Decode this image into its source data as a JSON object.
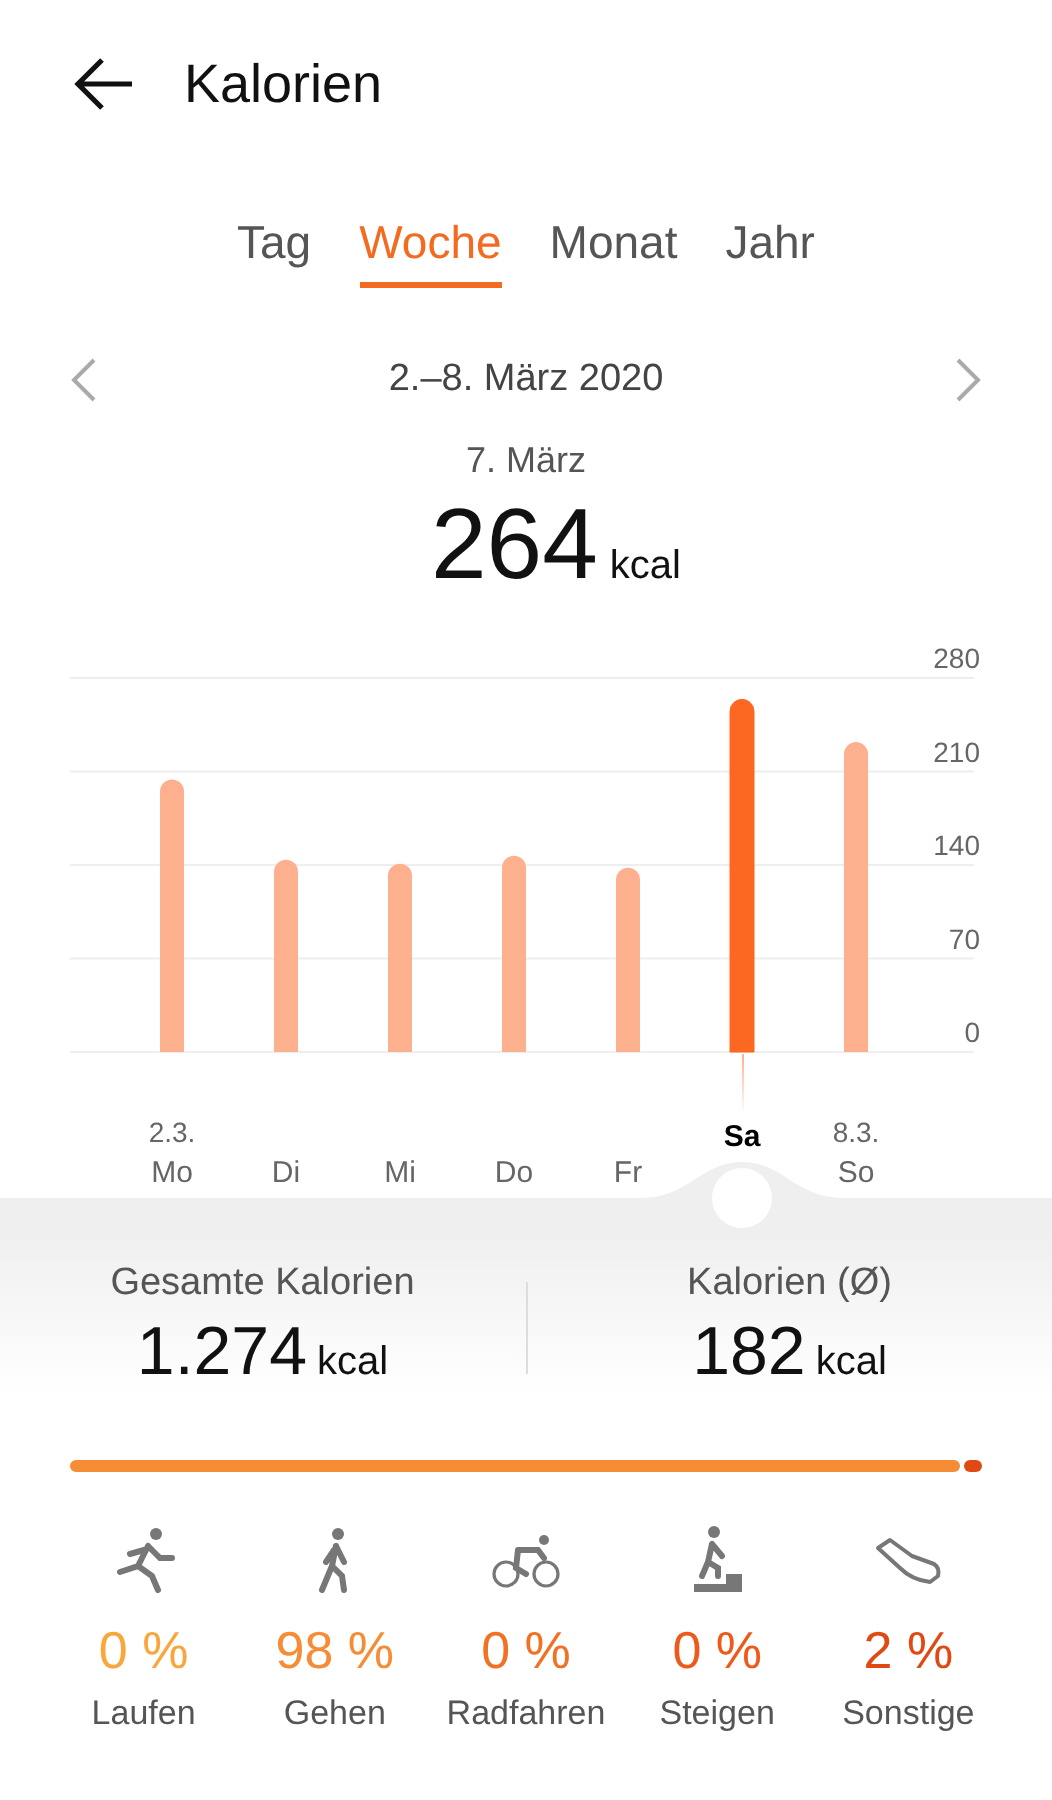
{
  "header": {
    "title": "Kalorien"
  },
  "tabs": [
    {
      "label": "Tag",
      "selected": false
    },
    {
      "label": "Woche",
      "selected": true
    },
    {
      "label": "Monat",
      "selected": false
    },
    {
      "label": "Jahr",
      "selected": false
    }
  ],
  "period": {
    "range": "2.–8. März 2020"
  },
  "selection": {
    "date": "7. März",
    "value": "264",
    "unit": "kcal"
  },
  "chart": {
    "chart_data": {
      "type": "bar",
      "categories": [
        "Mo",
        "Di",
        "Mi",
        "Do",
        "Fr",
        "Sa",
        "So"
      ],
      "grid": true,
      "series": [
        {
          "color": "#fdb08e",
          "values": [
            204,
            144,
            141,
            147,
            138,
            null,
            232
          ]
        },
        {
          "color": "#fc6722",
          "values": [
            null,
            null,
            null,
            null,
            null,
            264,
            null
          ]
        }
      ],
      "ylim": [
        0,
        280
      ],
      "yticks": [
        0,
        70,
        140,
        210,
        280
      ]
    },
    "days": [
      {
        "date": "2.3.",
        "selected": false
      },
      {
        "selected": false
      },
      {
        "selected": false
      },
      {
        "selected": false
      },
      {
        "selected": false
      },
      {
        "selected": true
      },
      {
        "date": "8.3.",
        "selected": false
      }
    ]
  },
  "summary": [
    {
      "label": "Gesamte Kalorien",
      "value": "1.274",
      "unit": "kcal"
    },
    {
      "label": "Kalorien (Ø)",
      "value": "182",
      "unit": "kcal"
    }
  ],
  "activities": [
    {
      "kind": "run",
      "percent": "0 %",
      "label": "Laufen",
      "color": "#f9a63c"
    },
    {
      "kind": "walk",
      "percent": "98 %",
      "label": "Gehen",
      "color": "#f68d36"
    },
    {
      "kind": "bike",
      "percent": "0 %",
      "label": "Radfahren",
      "color": "#f27225"
    },
    {
      "kind": "stairs",
      "percent": "0 %",
      "label": "Steigen",
      "color": "#ee5a1a"
    },
    {
      "kind": "other",
      "percent": "2 %",
      "label": "Sonstige",
      "color": "#e04a12"
    }
  ]
}
